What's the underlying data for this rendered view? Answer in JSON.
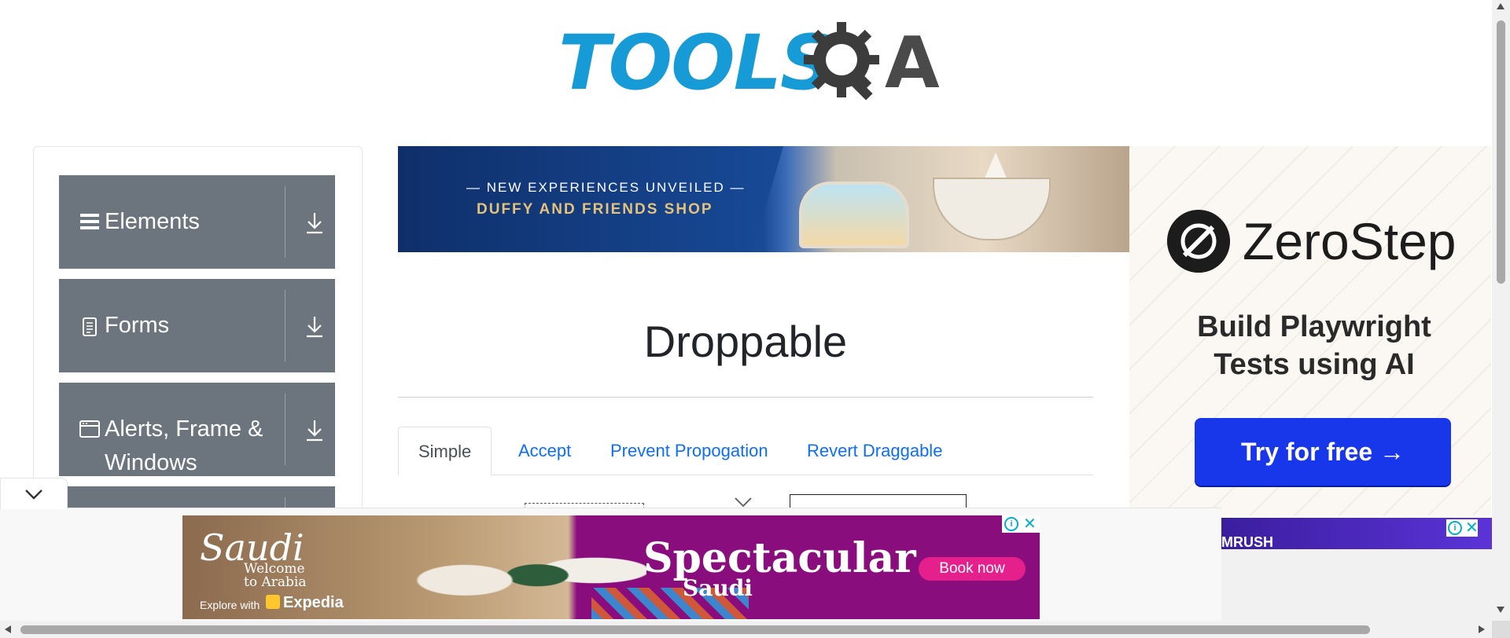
{
  "header": {
    "logo_tools": "TOOLS",
    "logo_a": "A",
    "brand_color": "#179bd7"
  },
  "sidebar": {
    "groups": [
      {
        "label": "Elements",
        "icon": "hamburger-icon"
      },
      {
        "label": "Forms",
        "icon": "document-icon"
      },
      {
        "label": "Alerts, Frame &",
        "label_line2": "Windows",
        "icon": "browser-window-icon"
      }
    ],
    "download_icon": "download-icon",
    "group_color": "#6c757d"
  },
  "banner": {
    "line1": "— NEW EXPERIENCES UNVEILED —",
    "line2": "DUFFY AND FRIENDS SHOP"
  },
  "main": {
    "title": "Droppable",
    "tabs": [
      {
        "label": "Simple",
        "active": true
      },
      {
        "label": "Accept",
        "active": false
      },
      {
        "label": "Prevent Propogation",
        "active": false
      },
      {
        "label": "Revert Draggable",
        "active": false
      }
    ],
    "link_color": "#0d6efd"
  },
  "right_ad": {
    "brand": "ZeroStep",
    "headline_line1": "Build Playwright",
    "headline_line2": "Tests using AI",
    "cta": "Try for free →",
    "cta_color": "#1837ea"
  },
  "bottom_ad": {
    "logo": "Saudi",
    "welcome_line1": "Welcome",
    "welcome_line2": "to Arabia",
    "explore": "Explore with",
    "partner": "Expedia",
    "headline": "Spectacular",
    "subline": "Saudi",
    "cta": "Book now",
    "accent": "#8a0d7e"
  },
  "side_ad": {
    "brand": "MRUSH"
  }
}
